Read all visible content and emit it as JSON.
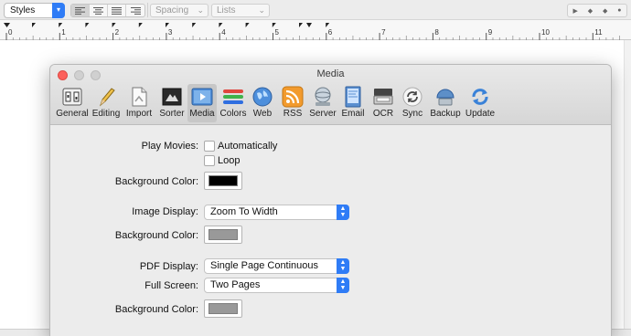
{
  "format_bar": {
    "styles_label": "Styles",
    "spacing_label": "Spacing",
    "lists_label": "Lists"
  },
  "ruler": {
    "numbers": [
      "0",
      "1",
      "2",
      "3",
      "4",
      "5",
      "6",
      "7",
      "8",
      "9",
      "10",
      "11"
    ]
  },
  "window": {
    "title": "Media",
    "toolbar": [
      {
        "label": "General",
        "icon": "general-icon"
      },
      {
        "label": "Editing",
        "icon": "pencil-icon"
      },
      {
        "label": "Import",
        "icon": "import-icon"
      },
      {
        "label": "Sorter",
        "icon": "sorter-icon"
      },
      {
        "label": "Media",
        "icon": "media-icon",
        "active": true
      },
      {
        "label": "Colors",
        "icon": "colors-icon"
      },
      {
        "label": "Web",
        "icon": "globe-icon"
      },
      {
        "label": "RSS",
        "icon": "rss-icon"
      },
      {
        "label": "Server",
        "icon": "server-icon"
      },
      {
        "label": "Email",
        "icon": "email-icon"
      },
      {
        "label": "OCR",
        "icon": "scanner-icon"
      },
      {
        "label": "Sync",
        "icon": "sync-icon"
      },
      {
        "label": "Backup",
        "icon": "backup-icon"
      },
      {
        "label": "Update",
        "icon": "update-icon"
      }
    ],
    "form": {
      "play_movies_label": "Play Movies:",
      "automatically_label": "Automatically",
      "loop_label": "Loop",
      "background_color_label": "Background Color:",
      "movie_bg_color": "#000000",
      "image_display_label": "Image Display:",
      "image_display_value": "Zoom To Width",
      "image_bg_color": "#999999",
      "pdf_display_label": "PDF Display:",
      "pdf_display_value": "Single Page Continuous",
      "full_screen_label": "Full Screen:",
      "full_screen_value": "Two Pages",
      "pdf_bg_color": "#999999"
    }
  },
  "colors": {
    "accent": "#2f7cf6",
    "close_button": "#fc605b"
  }
}
